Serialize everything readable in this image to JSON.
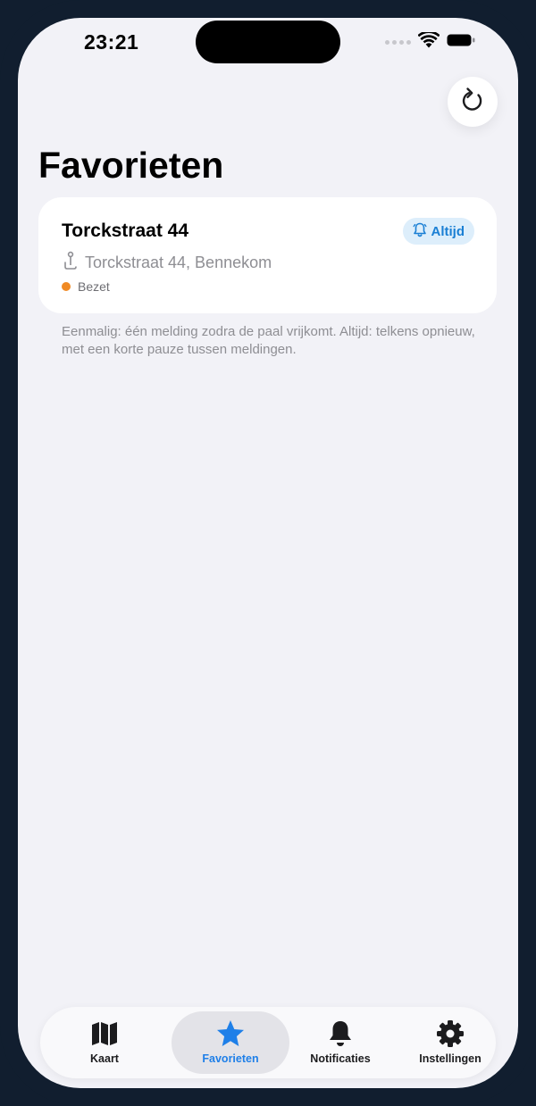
{
  "status_bar": {
    "time": "23:21"
  },
  "header": {
    "title": "Favorieten",
    "refresh_icon": "refresh-icon"
  },
  "favorites": [
    {
      "name": "Torckstraat 44",
      "address": "Torckstraat 44, Bennekom",
      "status": "Bezet",
      "status_color": "#f08a24",
      "notify_label": "Altijd",
      "notify_icon": "bell-icon"
    }
  ],
  "explanation": "Eenmalig: één melding zodra de paal vrijkomt. Altijd: telkens opnieuw, met een korte pauze tussen meldingen.",
  "tab_bar": {
    "tabs": [
      {
        "label": "Kaart",
        "icon": "map-icon",
        "active": false
      },
      {
        "label": "Favorieten",
        "icon": "star-icon",
        "active": true
      },
      {
        "label": "Notificaties",
        "icon": "bell-icon",
        "active": false
      },
      {
        "label": "Instellingen",
        "icon": "gear-icon",
        "active": false
      }
    ]
  },
  "colors": {
    "accent": "#1e7fe8",
    "background": "#f2f2f7",
    "frame": "#111e2f"
  }
}
